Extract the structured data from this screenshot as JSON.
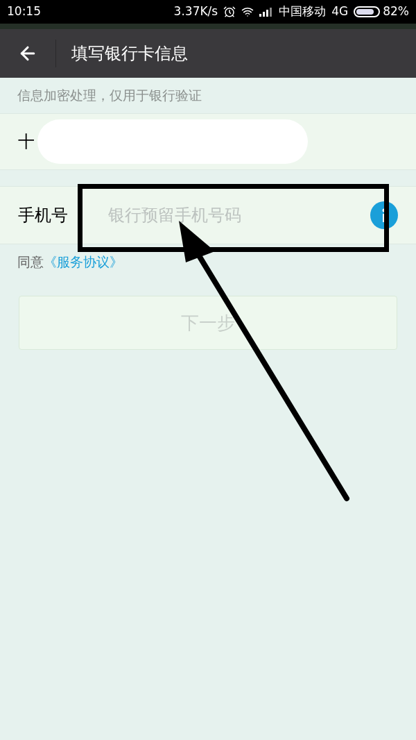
{
  "status_bar": {
    "time": "10:15",
    "speed": "3.37K/s",
    "carrier": "中国移动",
    "network": "4G",
    "battery": "82%"
  },
  "header": {
    "title": "填写银行卡信息"
  },
  "notice": "信息加密处理，仅用于银行验证",
  "card_row": {
    "label": "十",
    "redacted": true
  },
  "phone_row": {
    "label": "手机号",
    "placeholder": "银行预留手机号码"
  },
  "agreement": {
    "text": "同意",
    "link": "《服务协议》"
  },
  "next_button": {
    "label": "下一步",
    "disabled": true
  },
  "annotation": {
    "highlight": true,
    "arrow": true
  }
}
